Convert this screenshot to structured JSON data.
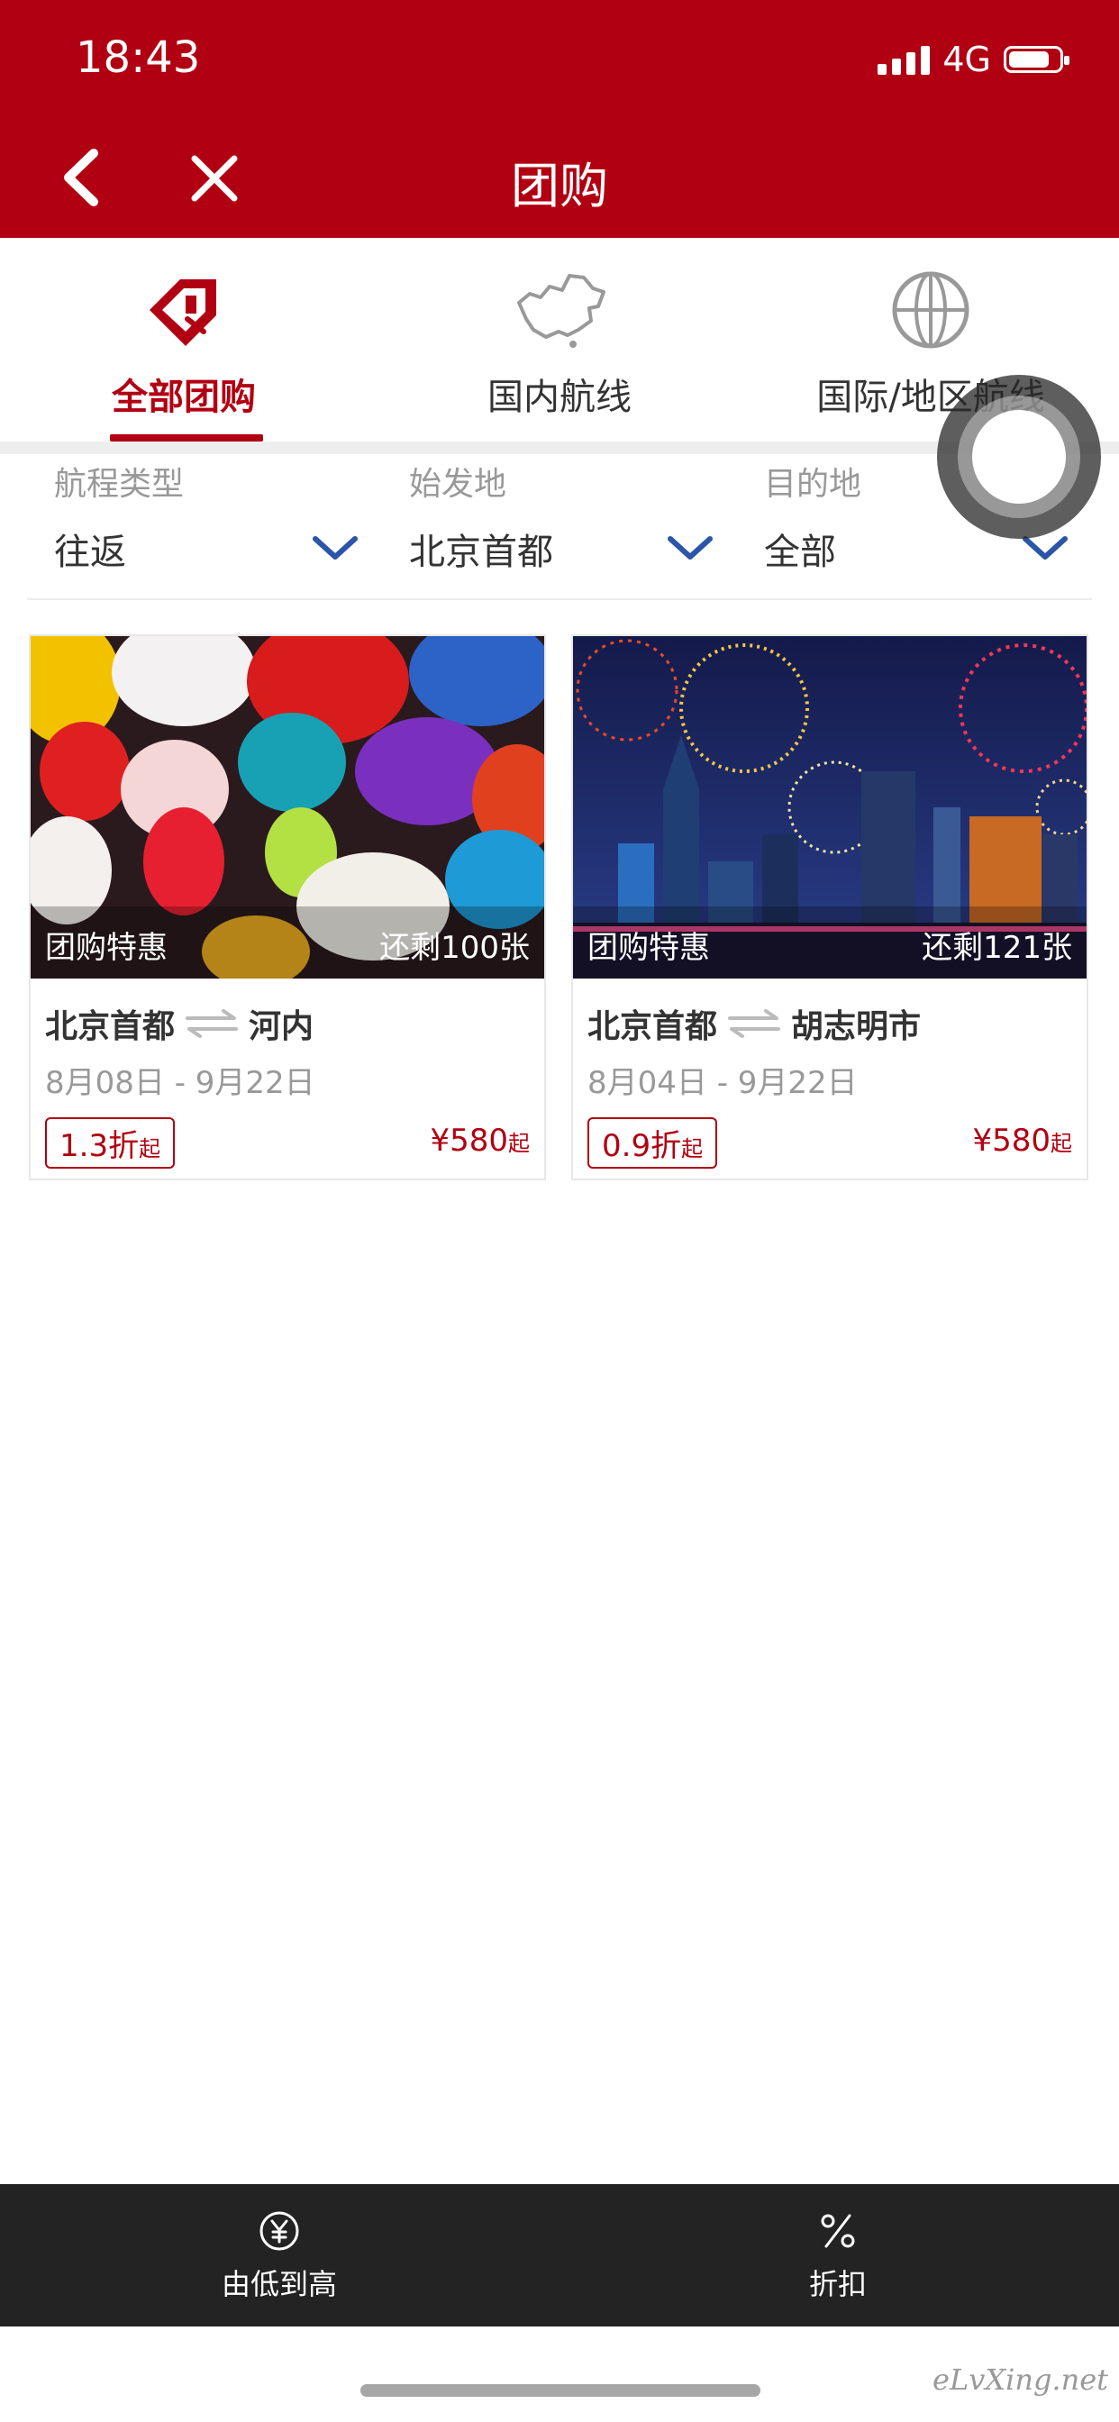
{
  "status_bar": {
    "time": "18:43",
    "network": "4G"
  },
  "header": {
    "title": "团购"
  },
  "tabs": [
    {
      "label": "全部团购",
      "icon": "tag-icon",
      "active": true
    },
    {
      "label": "国内航线",
      "icon": "china-map-icon",
      "active": false
    },
    {
      "label": "国际/地区航线",
      "icon": "globe-icon",
      "active": false
    }
  ],
  "filters": [
    {
      "label": "航程类型",
      "value": "往返"
    },
    {
      "label": "始发地",
      "value": "北京首都"
    },
    {
      "label": "目的地",
      "value": "全部"
    }
  ],
  "deals": [
    {
      "tag": "团购特惠",
      "remaining": "还剩100张",
      "from": "北京首都",
      "to": "河内",
      "dates": "8月08日 - 9月22日",
      "discount": "1.3折",
      "discount_suffix": "起",
      "price": "¥580",
      "price_suffix": "起",
      "image": "lanterns"
    },
    {
      "tag": "团购特惠",
      "remaining": "还剩121张",
      "from": "北京首都",
      "to": "胡志明市",
      "dates": "8月04日 - 9月22日",
      "discount": "0.9折",
      "discount_suffix": "起",
      "price": "¥580",
      "price_suffix": "起",
      "image": "fireworks-city"
    }
  ],
  "bottom_bar": [
    {
      "label": "由低到高",
      "icon": "yen-icon"
    },
    {
      "label": "折扣",
      "icon": "percent-icon"
    }
  ],
  "watermark": "eLvXing.net",
  "colors": {
    "brand": "#b10012",
    "filter_chevron": "#2b55a8",
    "bottom_bar": "#232323"
  }
}
